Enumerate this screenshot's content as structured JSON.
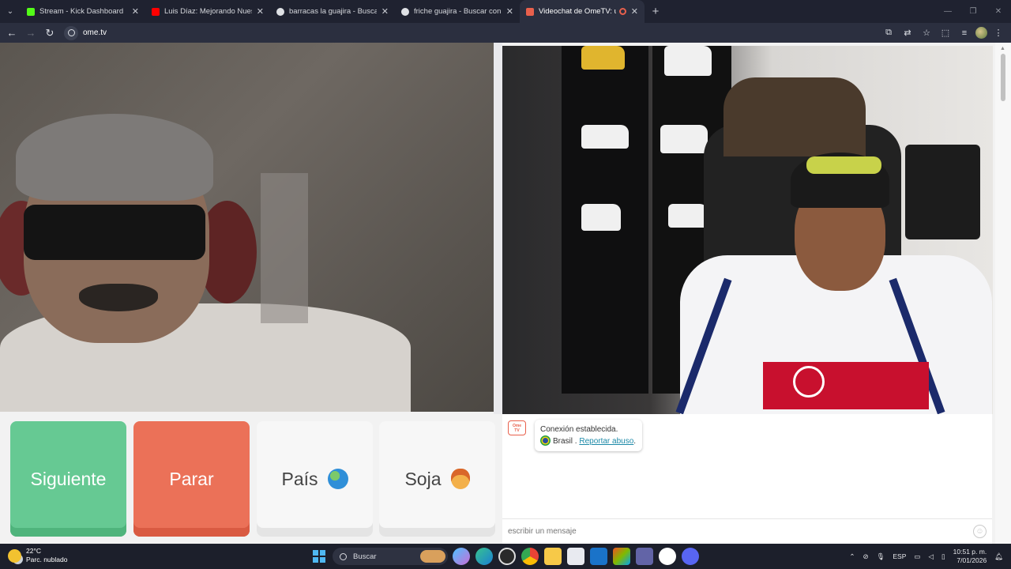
{
  "browser": {
    "tabs": [
      {
        "title": "Stream - Kick Dashboard",
        "favicon_color": "#53fc18",
        "active": false
      },
      {
        "title": "Luis Díaz: Mejorando Nuestro N",
        "favicon_color": "#ff0000",
        "active": false
      },
      {
        "title": "barracas la guajira - Buscar con",
        "favicon_color": "#dfe1e5",
        "active": false
      },
      {
        "title": "friche guajira - Buscar con Goo",
        "favicon_color": "#dfe1e5",
        "active": false
      },
      {
        "title": "Videochat de OmeTV: una",
        "favicon_color": "#e8604c",
        "active": true
      }
    ],
    "url": "ome.tv"
  },
  "buttons": {
    "next": "Siguiente",
    "stop": "Parar",
    "country": "País",
    "country_icon": "globe-icon",
    "gender": "Soja",
    "gender_icon": "person-icon"
  },
  "chat": {
    "logo_line1": "Ome",
    "logo_line2": "TV",
    "status": "Conexión establecida.",
    "country": "Brasil",
    "separator": " . ",
    "report": "Reportar abuso",
    "period": ".",
    "input_placeholder": "escribir un mensaje"
  },
  "taskbar": {
    "temperature": "22°C",
    "weather": "Parc. nublado",
    "search": "Buscar",
    "language": "ESP",
    "time": "10:51 p. m.",
    "date": "7/01/2026"
  },
  "colors": {
    "next": "#66c993",
    "stop": "#eb7158",
    "link": "#1d8aa8"
  }
}
